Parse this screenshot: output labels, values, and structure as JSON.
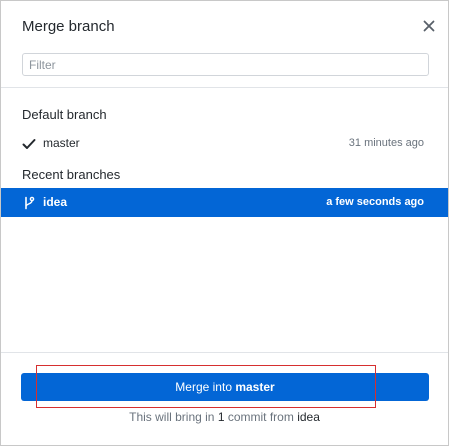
{
  "dialog": {
    "title": "Merge branch",
    "close_icon": "close-icon"
  },
  "filter": {
    "placeholder": "Filter",
    "value": ""
  },
  "default_section": {
    "title": "Default branch",
    "branch": {
      "icon": "check-icon",
      "name": "master",
      "time": "31 minutes ago"
    }
  },
  "recent_section": {
    "title": "Recent branches",
    "branches": [
      {
        "icon": "git-branch-icon",
        "name": "idea",
        "time": "a few seconds ago",
        "selected": true
      }
    ]
  },
  "footer": {
    "button_prefix": "Merge into ",
    "button_target": "master",
    "info_prefix": "This will bring in ",
    "info_count": "1",
    "info_middle": " commit from ",
    "info_branch": "idea"
  },
  "colors": {
    "accent": "#0366d6",
    "annotation": "#d62f2f"
  }
}
